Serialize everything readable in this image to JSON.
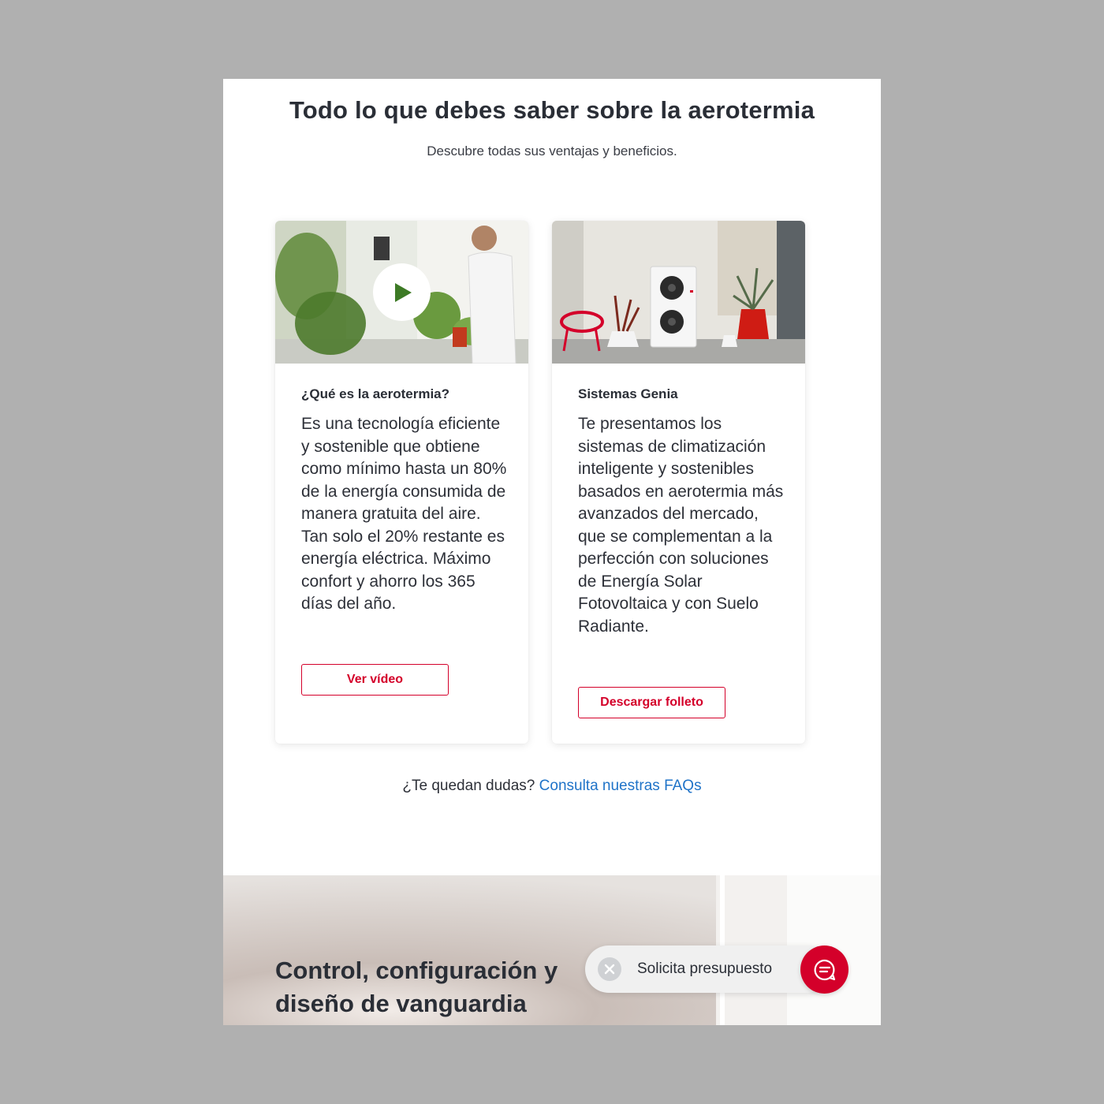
{
  "header": {
    "title": "Todo lo que debes saber sobre la aerotermia",
    "subtitle": "Descubre todas sus ventajas y beneficios."
  },
  "cards": [
    {
      "heading": "¿Qué es la aerotermia?",
      "body": "Es una tecnología eficiente y sostenible que obtiene como mínimo hasta un 80% de la energía consumida de manera gratuita del aire. Tan solo el 20% restante es energía eléctrica. Máximo confort y ahorro los 365 días del año.",
      "button_label": "Ver vídeo",
      "media": "video-thumbnail"
    },
    {
      "heading": "Sistemas Genia",
      "body": "Te presentamos los sistemas de climatización inteligente y sostenibles basados en aerotermia más avanzados del mercado, que se complementan a la perfección con soluciones de Energía Solar Fotovoltaica y con Suelo Radiante.",
      "button_label": "Descargar folleto",
      "media": "product-photo"
    }
  ],
  "faq": {
    "question": "¿Te quedan dudas?",
    "link_text": "Consulta nuestras FAQs"
  },
  "hero": {
    "title": "Control, configuración y diseño de vanguardia"
  },
  "floating_cta": {
    "label": "Solicita presupuesto",
    "close_icon": "close-icon",
    "chat_icon": "chat-icon"
  },
  "colors": {
    "accent": "#d4002a",
    "link": "#1f73c8",
    "text": "#2d3038"
  }
}
